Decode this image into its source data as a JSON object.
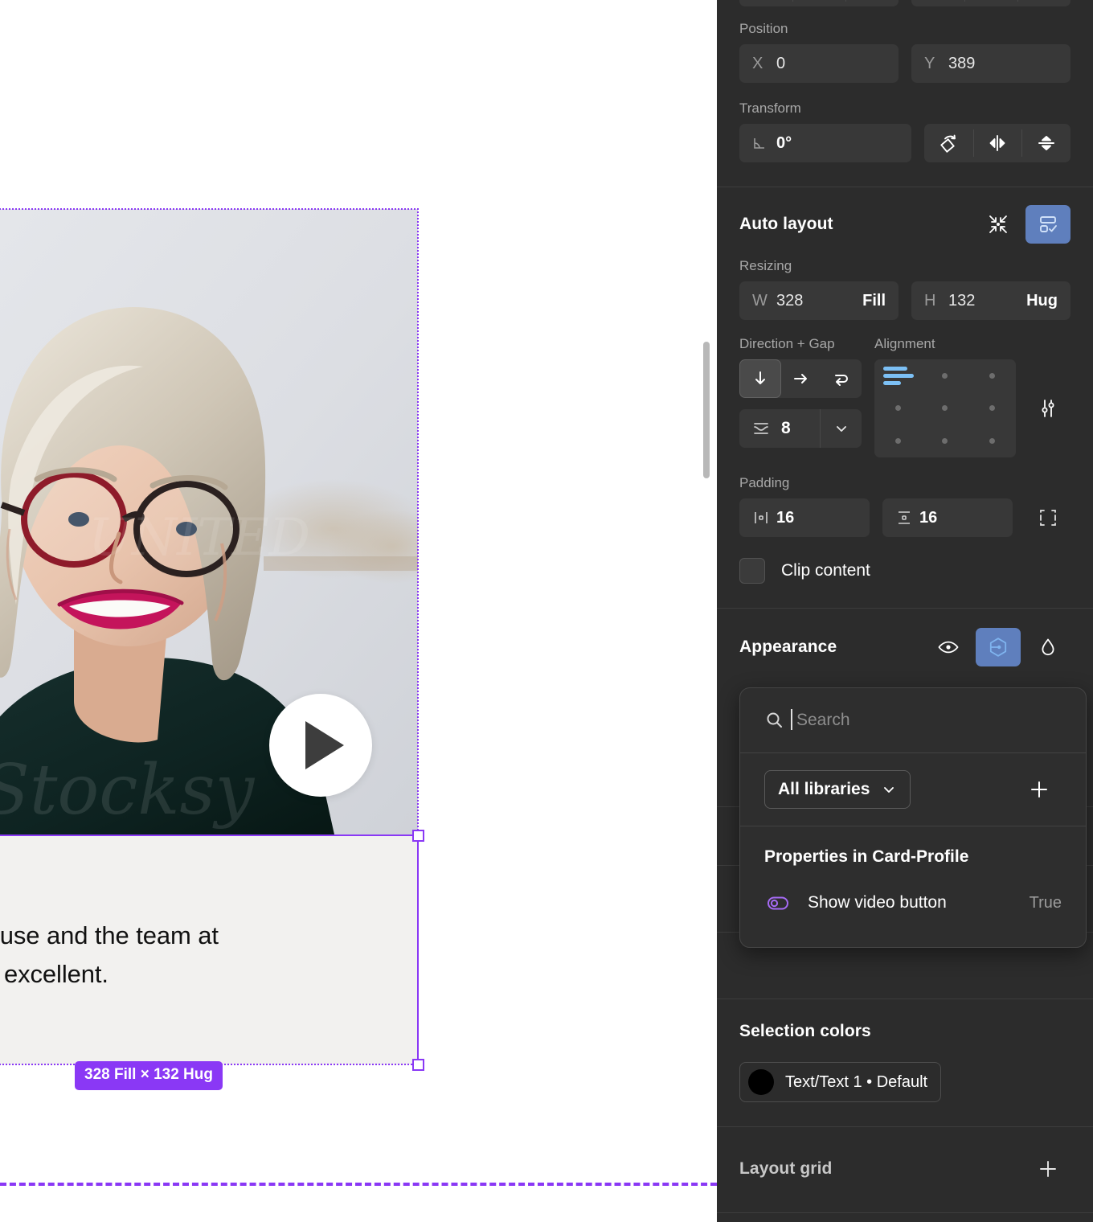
{
  "canvas": {
    "card": {
      "quote_line1": "easy to use and the team at",
      "quote_line2": "one are excellent."
    },
    "play_button_label": "play-video",
    "size_badge": "328 Fill × 132 Hug",
    "selection_color": "#8a38f5"
  },
  "panel": {
    "position": {
      "label": "Position",
      "x_prefix": "X",
      "x_value": "0",
      "y_prefix": "Y",
      "y_value": "389"
    },
    "transform": {
      "label": "Transform",
      "rotation_value": "0°",
      "rotate_icon": "rotate-icon",
      "flip_h_icon": "flip-horizontal-icon",
      "flip_v_icon": "flip-vertical-icon"
    },
    "auto_layout": {
      "title": "Auto layout",
      "collapse_icon": "collapse-icon",
      "settings_icon": "auto-layout-settings-icon",
      "resizing_label": "Resizing",
      "width_prefix": "W",
      "width_value": "328",
      "width_mode": "Fill",
      "height_prefix": "H",
      "height_value": "132",
      "height_mode": "Hug",
      "direction_label": "Direction + Gap",
      "alignment_label": "Alignment",
      "direction_vertical_icon": "arrow-down-icon",
      "direction_horizontal_icon": "arrow-right-icon",
      "direction_wrap_icon": "wrap-icon",
      "gap_value": "8",
      "gap_icon": "gap-icon",
      "gap_dropdown_icon": "chevron-down-icon",
      "advanced_icon": "sliders-icon",
      "padding_label": "Padding",
      "padding_horizontal_value": "16",
      "padding_vertical_value": "16",
      "padding_individual_icon": "padding-sides-icon",
      "clip_content_label": "Clip content",
      "clip_content_checked": false
    },
    "appearance": {
      "title": "Appearance",
      "visibility_icon": "eye-icon",
      "variables_icon": "variables-hexagon-icon",
      "opacity_icon": "droplet-icon"
    },
    "popover": {
      "search_placeholder": "Search",
      "search_icon": "search-icon",
      "libraries_label": "All libraries",
      "libraries_chevron_icon": "chevron-down-icon",
      "add_icon": "plus-icon",
      "properties_title": "Properties in Card-Profile",
      "properties": [
        {
          "icon": "boolean-toggle-icon",
          "name": "Show video button",
          "value": "True"
        }
      ]
    },
    "selection_colors": {
      "title": "Selection colors",
      "swatches": [
        {
          "color": "#000000",
          "label": "Text/Text 1 • Default"
        }
      ]
    },
    "layout_grid": {
      "title": "Layout grid",
      "add_icon": "plus-icon"
    }
  }
}
